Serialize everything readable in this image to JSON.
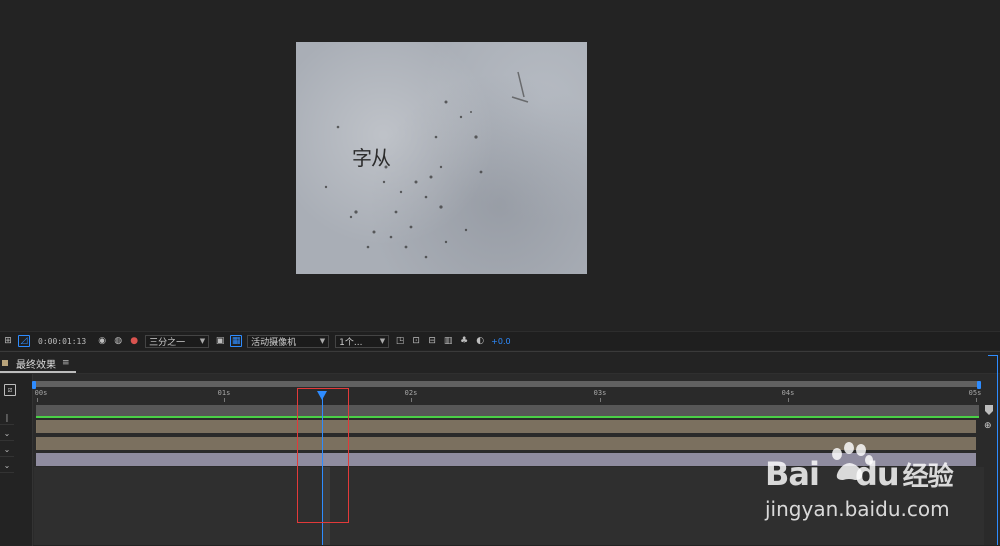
{
  "viewer": {
    "canvas_text": "字从"
  },
  "toolbar": {
    "timecode": "0:00:01:13",
    "resolution": "三分之一",
    "camera": "活动摄像机",
    "views": "1个...",
    "exposure": "+0.0",
    "icons": [
      "snapshot-icon",
      "show-snapshot-icon",
      "color-channels-icon",
      "fast-preview-icon",
      "transparency-grid-icon",
      "mask-icon",
      "3d-view-icon",
      "region-of-interest-icon",
      "toggle-pixel-aspect-icon",
      "flowchart-icon",
      "reset-exposure-icon"
    ]
  },
  "timeline": {
    "tab_label": "最终效果",
    "tab_color": "#b9a47b",
    "ticks": [
      "00s",
      "01s",
      "02s",
      "03s",
      "04s",
      "05s"
    ],
    "layer_colors": [
      "#7b705f",
      "#7b705f",
      "#8f8c9f"
    ],
    "playhead_color": "#2e8cff"
  },
  "watermark": {
    "brand": "Bai",
    "brand_suffix": "du",
    "brand_cn": "经验",
    "url": "jingyan.baidu.com"
  }
}
